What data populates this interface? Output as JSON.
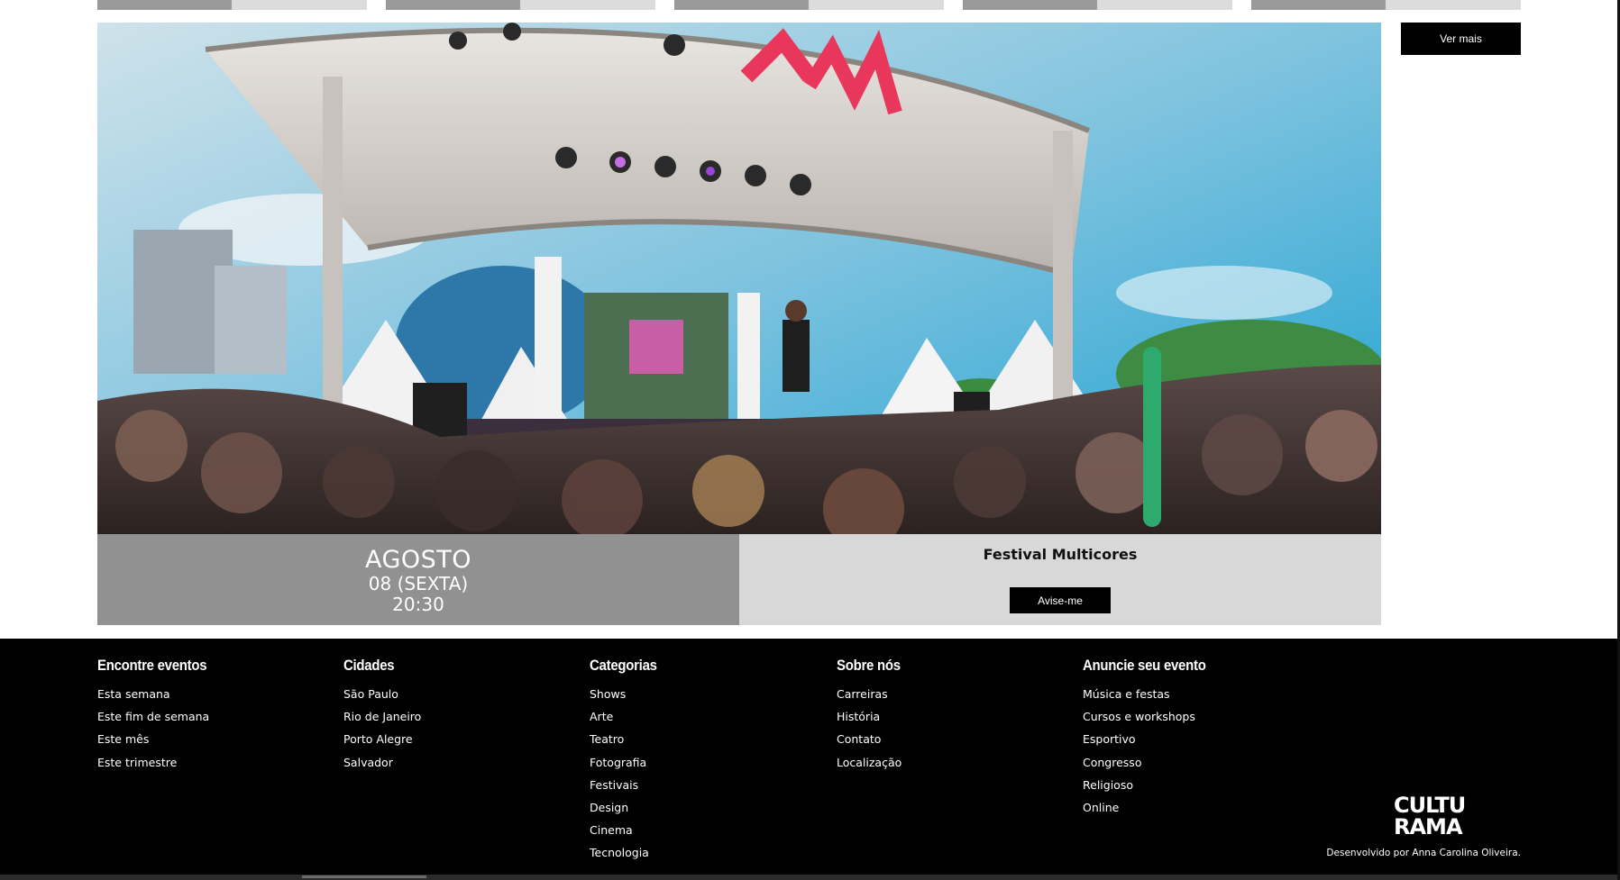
{
  "top_cards": {
    "count": 5
  },
  "see_more": {
    "label": "Ver mais"
  },
  "event": {
    "image_icon": "concert-stage-photo",
    "month": "AGOSTO",
    "day": "08 (SEXTA)",
    "time": "20:30",
    "title": "Festival Multicores",
    "notify_label": "Avise-me"
  },
  "footer": {
    "columns": [
      {
        "title": "Encontre eventos",
        "items": [
          "Esta semana",
          "Este fim de semana",
          "Este mês",
          "Este trimestre"
        ]
      },
      {
        "title": "Cidades",
        "items": [
          "São Paulo",
          "Rio de Janeiro",
          "Porto Alegre",
          "Salvador"
        ]
      },
      {
        "title": "Categorias",
        "items": [
          "Shows",
          "Arte",
          "Teatro",
          "Fotografia",
          "Festivais",
          "Design",
          "Cinema",
          "Tecnologia"
        ]
      },
      {
        "title": "Sobre nós",
        "items": [
          "Carreiras",
          "História",
          "Contato",
          "Localização"
        ]
      },
      {
        "title": "Anuncie seu evento",
        "items": [
          "Música e festas",
          "Cursos e workshops",
          "Esportivo",
          "Congresso",
          "Religioso",
          "Online"
        ]
      }
    ],
    "logo_line1": "CULTU",
    "logo_line2": "RAMA",
    "credit": "Desenvolvido por Anna Carolina Oliveira."
  }
}
